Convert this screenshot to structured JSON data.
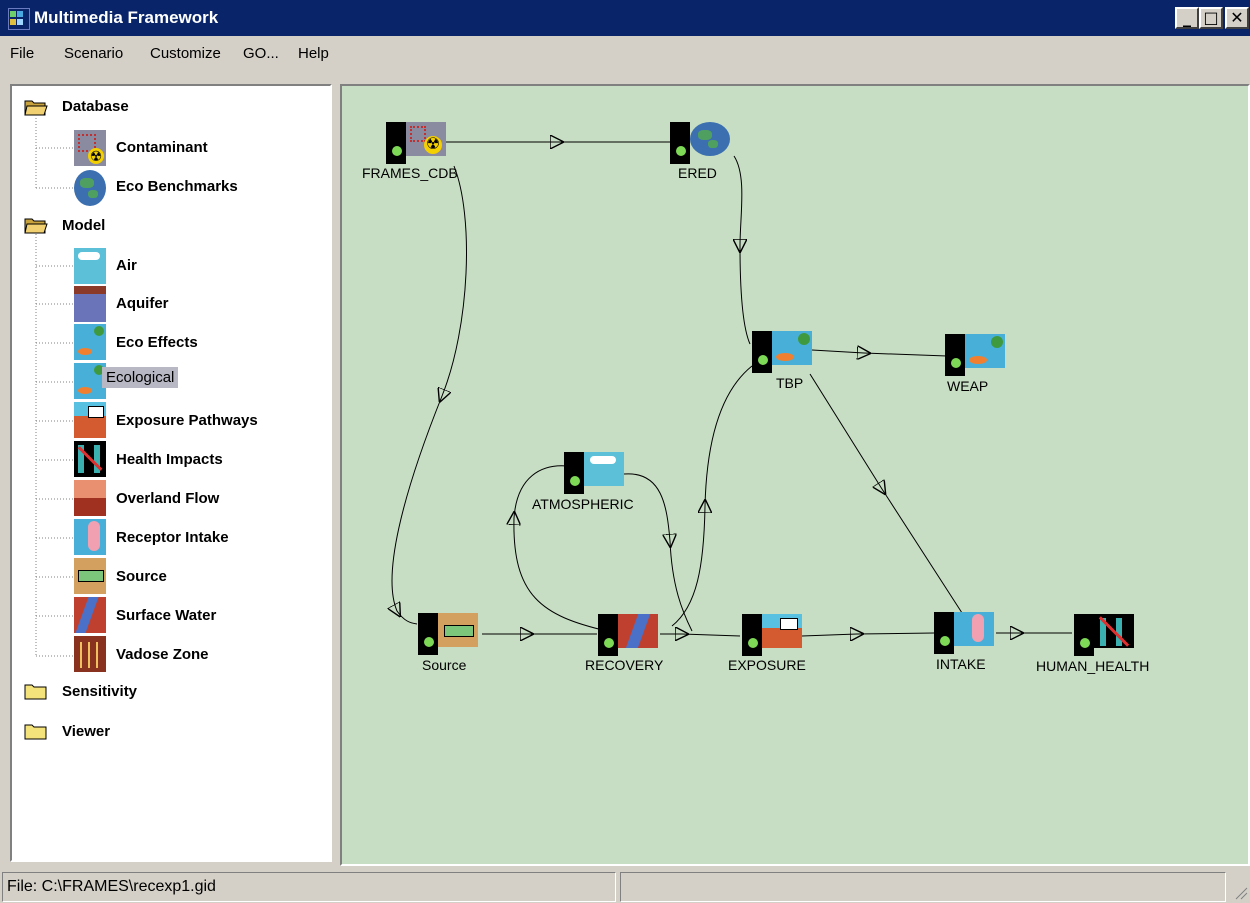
{
  "window": {
    "title": "Multimedia Framework"
  },
  "menu": [
    "File",
    "Scenario",
    "Customize",
    "GO...",
    "Help"
  ],
  "tree": {
    "database": {
      "label": "Database",
      "items": [
        "Contaminant",
        "Eco Benchmarks"
      ]
    },
    "model": {
      "label": "Model",
      "items": [
        "Air",
        "Aquifer",
        "Eco Effects",
        "Ecological",
        "Exposure Pathways",
        "Health Impacts",
        "Overland Flow",
        "Receptor Intake",
        "Source",
        "Surface Water",
        "Vadose Zone"
      ]
    },
    "sensitivity": {
      "label": "Sensitivity"
    },
    "viewer": {
      "label": "Viewer"
    },
    "selected": "Ecological"
  },
  "canvas": {
    "nodes": [
      "FRAMES_CDB",
      "ERED",
      "TBP",
      "WEAP",
      "ATMOSPHERIC",
      "Source",
      "RECOVERY",
      "EXPOSURE",
      "INTAKE",
      "HUMAN_HEALTH"
    ]
  },
  "status": {
    "file": "File: C:\\FRAMES\\recexp1.gid",
    "right": ""
  },
  "colors": {
    "canvas_bg": "#c7dec4",
    "titlebar": "#0a246a",
    "led": "#7ed957"
  }
}
